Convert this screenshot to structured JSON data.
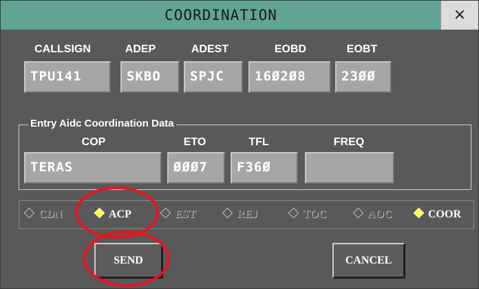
{
  "window": {
    "title": "COORDINATION",
    "close_label": "×"
  },
  "flight": {
    "labels": {
      "callsign": "CALLSIGN",
      "adep": "ADEP",
      "adest": "ADEST",
      "eobd": "EOBD",
      "eobt": "EOBT"
    },
    "values": {
      "callsign": "TPU141",
      "adep": "SKBO",
      "adest": "SPJC",
      "eobd": "16Ø2Ø8",
      "eobt": "23ØØ"
    }
  },
  "entry": {
    "legend": "Entry Aidc Coordination Data",
    "labels": {
      "cop": "COP",
      "eto": "ETO",
      "tfl": "TFL",
      "freq": "FREQ"
    },
    "values": {
      "cop": "TERAS",
      "eto": "ØØØ7",
      "tfl": "F36Ø",
      "freq": ""
    }
  },
  "status_options": [
    {
      "label": "CDN",
      "selected": false
    },
    {
      "label": "ACP",
      "selected": true
    },
    {
      "label": "EST",
      "selected": false
    },
    {
      "label": "REJ",
      "selected": false
    },
    {
      "label": "TOC",
      "selected": false
    },
    {
      "label": "AOC",
      "selected": false
    },
    {
      "label": "COOR",
      "selected": true
    }
  ],
  "buttons": {
    "send": "SEND",
    "cancel": "CANCEL"
  },
  "colors": {
    "titlebar": "#61a394",
    "panel": "#595959",
    "field": "#a6a6a6",
    "selected_marker": "#ffff33",
    "highlight": "#e8141c"
  }
}
